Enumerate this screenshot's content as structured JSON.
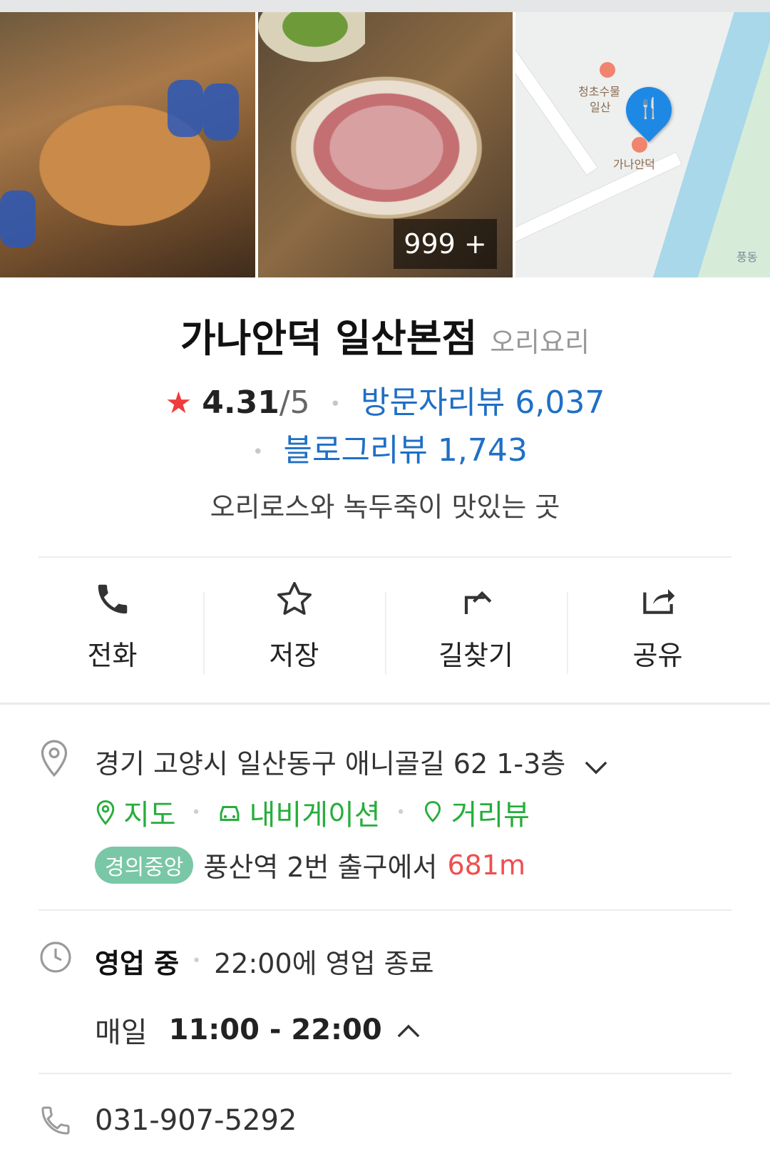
{
  "photos": {
    "more_count": "999 +"
  },
  "map": {
    "label_top": "청초수물",
    "label_top2": "일산",
    "label_pin": "가나안덕",
    "label_corner": "풍동"
  },
  "place": {
    "name": "가나안덕 일산본점",
    "category": "오리요리",
    "rating": "4.31",
    "rating_max": "/5",
    "visitor_reviews": "방문자리뷰 6,037",
    "blog_reviews": "블로그리뷰 1,743",
    "description": "오리로스와 녹두죽이 맛있는 곳"
  },
  "actions": [
    {
      "label": "전화",
      "icon": "phone-icon"
    },
    {
      "label": "저장",
      "icon": "star-outline-icon"
    },
    {
      "label": "길찾기",
      "icon": "directions-icon"
    },
    {
      "label": "공유",
      "icon": "share-icon"
    }
  ],
  "address": {
    "text": "경기 고양시 일산동구 애니골길 62 1-3층",
    "links": {
      "map": "지도",
      "navigation": "내비게이션",
      "street_view": "거리뷰"
    },
    "subway_line": "경의중앙",
    "station_text": "풍산역 2번 출구에서",
    "distance": "681m"
  },
  "hours": {
    "status": "영업 중",
    "close_text": "22:00에 영업 종료",
    "day": "매일",
    "range": "11:00 - 22:00"
  },
  "phone": "031-907-5292",
  "colors": {
    "green": "#27ad3c",
    "blue": "#1f6fc5",
    "star": "#ef3b3b",
    "distance": "#ef4f4f",
    "subway": "#79c7a6"
  }
}
